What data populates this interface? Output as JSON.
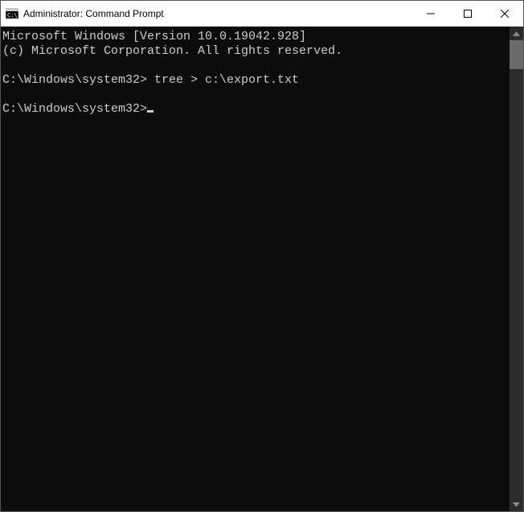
{
  "window": {
    "title": "Administrator: Command Prompt"
  },
  "terminal": {
    "header_line1": "Microsoft Windows [Version 10.0.19042.928]",
    "header_line2": "(c) Microsoft Corporation. All rights reserved.",
    "prompt1_path": "C:\\Windows\\system32>",
    "prompt1_command": " tree > c:\\export.txt",
    "prompt2_path": "C:\\Windows\\system32>"
  },
  "icons": {
    "app": "cmd-icon",
    "minimize": "minimize-icon",
    "maximize": "maximize-icon",
    "close": "close-icon",
    "scroll_up": "scroll-up-icon",
    "scroll_down": "scroll-down-icon"
  }
}
